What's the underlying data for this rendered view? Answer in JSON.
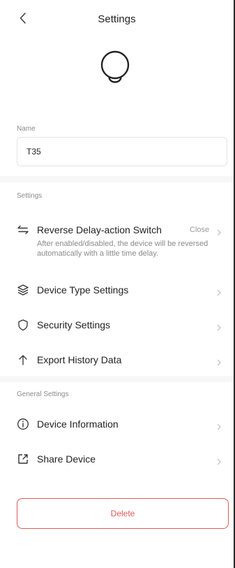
{
  "header": {
    "title": "Settings"
  },
  "name": {
    "label": "Name",
    "value": "T35"
  },
  "settings_section": {
    "label": "Settings",
    "items": [
      {
        "label": "Reverse Delay-action Switch",
        "value": "Close",
        "description": "After enabled/disabled, the device will be reversed automatically with a little time delay.",
        "icon": "swap-arrows-icon"
      },
      {
        "label": "Device Type Settings",
        "icon": "layers-icon"
      },
      {
        "label": "Security Settings",
        "icon": "shield-icon"
      },
      {
        "label": "Export History Data",
        "icon": "arrow-up-icon"
      }
    ]
  },
  "general_section": {
    "label": "General Settings",
    "items": [
      {
        "label": "Device Information",
        "icon": "info-icon"
      },
      {
        "label": "Share Device",
        "icon": "share-icon"
      }
    ]
  },
  "delete_label": "Delete",
  "colors": {
    "accent_red": "#e05a57",
    "muted_text": "#8a8a8a",
    "divider": "#f7f7f7"
  }
}
